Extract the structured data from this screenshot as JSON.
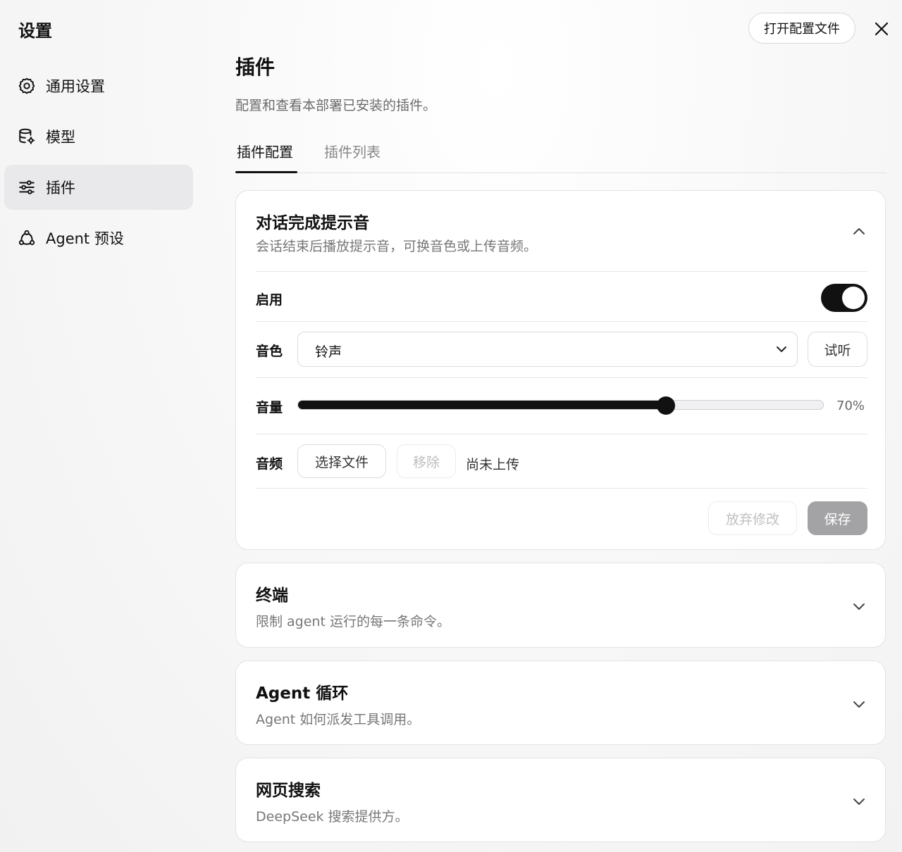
{
  "app": {
    "title": "设置",
    "open_config_label": "打开配置文件"
  },
  "sidebar": {
    "items": [
      {
        "label": "通用设置",
        "icon": "gear-icon"
      },
      {
        "label": "模型",
        "icon": "database-gear-icon"
      },
      {
        "label": "插件",
        "icon": "sliders-icon",
        "active": true
      },
      {
        "label": "Agent 预设",
        "icon": "agent-cycle-icon"
      }
    ]
  },
  "page": {
    "title": "插件",
    "subtitle": "配置和查看本部署已安装的插件。",
    "tabs": [
      {
        "label": "插件配置",
        "active": true
      },
      {
        "label": "插件列表",
        "active": false
      }
    ]
  },
  "plugins": [
    {
      "title": "对话完成提示音",
      "description": "会话结束后播放提示音，可换音色或上传音频。",
      "expanded": true,
      "fields": {
        "enable_label": "启用",
        "enabled": true,
        "voice_label": "音色",
        "voice_value": "铃声",
        "preview_label": "试听",
        "volume_label": "音量",
        "volume": 0.7,
        "volume_text": "70%",
        "audio_label": "音频",
        "choose_file_label": "选择文件",
        "remove_label": "移除",
        "upload_status": "尚未上传"
      },
      "actions": {
        "discard_label": "放弃修改",
        "save_label": "保存"
      }
    },
    {
      "title": "终端",
      "description": "限制 agent 运行的每一条命令。",
      "expanded": false
    },
    {
      "title": "Agent 循环",
      "description": "Agent 如何派发工具调用。",
      "expanded": false
    },
    {
      "title": "网页搜索",
      "description": "DeepSeek 搜索提供方。",
      "expanded": false
    }
  ],
  "colors": {
    "accent": "#111111",
    "active_sidebar_bg": "#e9e9ec",
    "save_disabled_bg": "#a3a3a5"
  }
}
